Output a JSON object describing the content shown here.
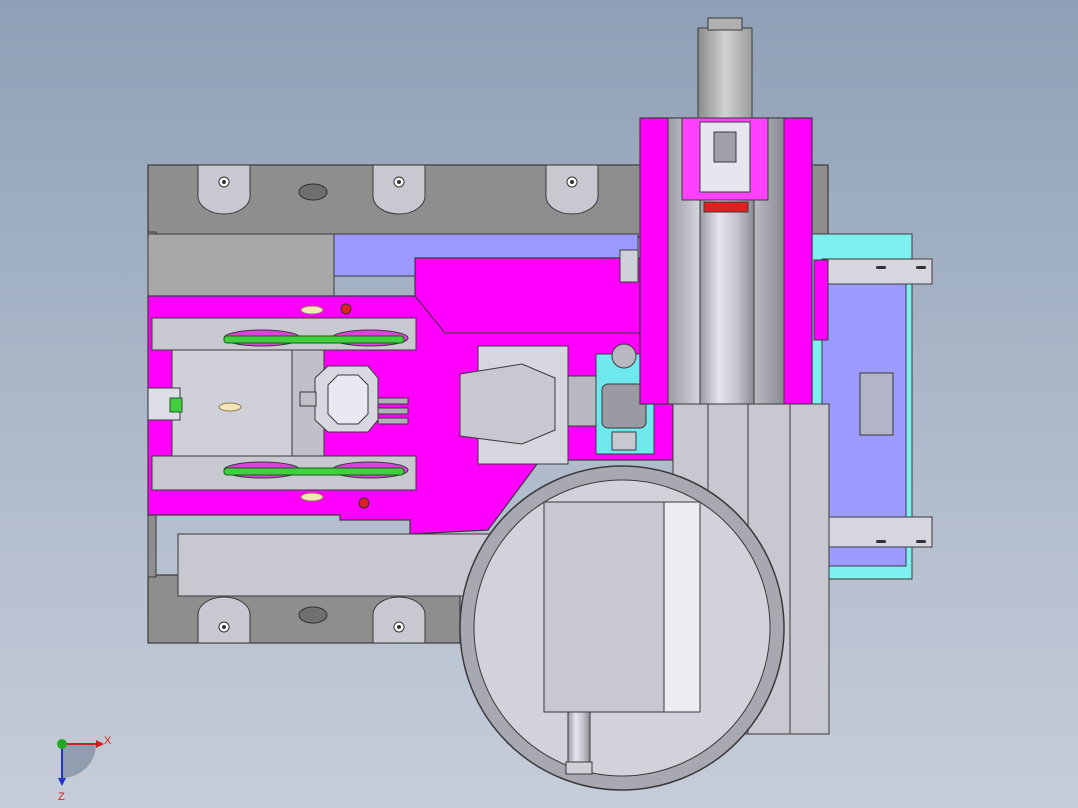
{
  "viewport": {
    "background_top": "#8f9fb5",
    "background_bottom": "#c6cdd8"
  },
  "colors": {
    "housing_gray": "#8e8e8e",
    "plate_light": "#c8c8d0",
    "magenta": "#ff00ff",
    "blue_plate": "#9a9aff",
    "cyan": "#7ff0f0",
    "belt_green": "#3fcf3f",
    "red_seal": "#e02020",
    "dark_edge": "#3a3a3a"
  },
  "triad": {
    "x_label": "X",
    "z_label": "Z",
    "icons": [
      "x-axis-arrow-icon",
      "z-axis-arrow-icon",
      "origin-sphere-icon"
    ]
  }
}
